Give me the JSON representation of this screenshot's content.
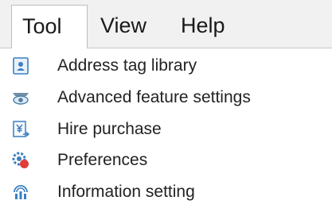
{
  "menubar": {
    "items": [
      {
        "label": "Tool",
        "state": "open"
      },
      {
        "label": "View"
      },
      {
        "label": "Help"
      }
    ]
  },
  "tool_menu": {
    "items": [
      {
        "label": "Address tag library",
        "icon": "address-book-icon"
      },
      {
        "label": "Advanced feature settings",
        "icon": "eye-settings-icon"
      },
      {
        "label": "Hire purchase",
        "icon": "yen-document-icon"
      },
      {
        "label": "Preferences",
        "icon": "preferences-gear-icon"
      },
      {
        "label": "Information setting",
        "icon": "information-setting-icon"
      }
    ]
  },
  "colors": {
    "menubar_bg": "#f1f1f1",
    "icon_blue": "#3a7fc1",
    "icon_red": "#e23b3b"
  }
}
